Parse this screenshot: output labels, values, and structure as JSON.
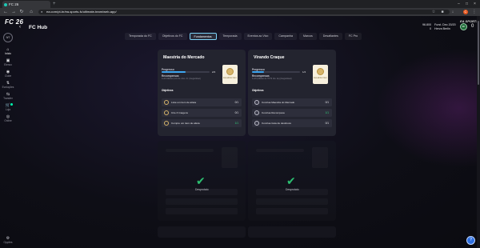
{
  "browser": {
    "tab_title": "FC 26",
    "url": "ea.com/pt-br/ea-sports-fc/ultimate-team/web-app/",
    "new_tab": "+",
    "profile_initial": "C"
  },
  "app": {
    "logo": "FC 26",
    "brand": "EA SPORTS",
    "page_title": "FC Hub",
    "level": "9/7",
    "coins": "96.800",
    "points": "0",
    "club_line1": "Furst. Dec 20/20",
    "club_line2": "Herva Berlin",
    "crest": "ZK",
    "notifications_count": "0"
  },
  "rail": [
    {
      "label": "Início",
      "icon": "home-icon"
    },
    {
      "label": "Elenco",
      "icon": "squad-icon"
    },
    {
      "label": "Clube",
      "icon": "club-icon"
    },
    {
      "label": "Evoluções",
      "icon": "evolutions-icon"
    },
    {
      "label": "Transfer",
      "icon": "transfer-icon"
    },
    {
      "label": "Loja",
      "icon": "store-icon"
    },
    {
      "label": "Online",
      "icon": "online-icon"
    }
  ],
  "options_label": "Opções",
  "tabs": [
    "Temporada do FC",
    "Objetivos do FC",
    "Fundamentos",
    "Temporada",
    "Eventos ao Vivo",
    "Campanha",
    "Marcos",
    "Desafiantes",
    "FC Pro"
  ],
  "active_tab": "Fundamentos",
  "cards": [
    {
      "title": "Maestria do Mercado",
      "progress_label": "Progresso",
      "progress_value": "2/4",
      "progress_fraction": 0.5,
      "rewards_label": "Recompensas",
      "rewards_text": "4+10 Atletas (com de Jovs. Fr. (Inegociável)",
      "badge_label": "Escudinho Ouro",
      "objectives_label": "Objetivos",
      "objectives": [
        {
          "text": "Liste um item de atleta",
          "value": "0/1",
          "done": false
        },
        {
          "text": "Crie 3 Imagens",
          "value": "0/1",
          "done": false
        },
        {
          "text": "Compre um item de atleta",
          "value": "1/1",
          "done": true
        }
      ]
    },
    {
      "title": "Virando Craque",
      "progress_label": "Progresso",
      "progress_value": "1/4",
      "progress_fraction": 0.25,
      "rewards_label": "Recompensas",
      "rewards_text": "4+16 (Atletas de 70/74 rdo. de) (Inegociável)",
      "badge_label": "Escudinho Ouro",
      "objectives_label": "Objetivos",
      "objectives": [
        {
          "text": "Conclua Maestria do Mercado",
          "value": "0/1",
          "done": false
        },
        {
          "text": "Conclua Recompesa",
          "value": "1/1",
          "done": true
        },
        {
          "text": "Conclua Guia de destinoss",
          "value": "0/1",
          "done": false
        }
      ]
    }
  ],
  "unlocked_label": "Desprotato",
  "help": "?",
  "colors": {
    "accent": "#3da6f0",
    "success": "#2fd27a",
    "card": "#23242f"
  }
}
